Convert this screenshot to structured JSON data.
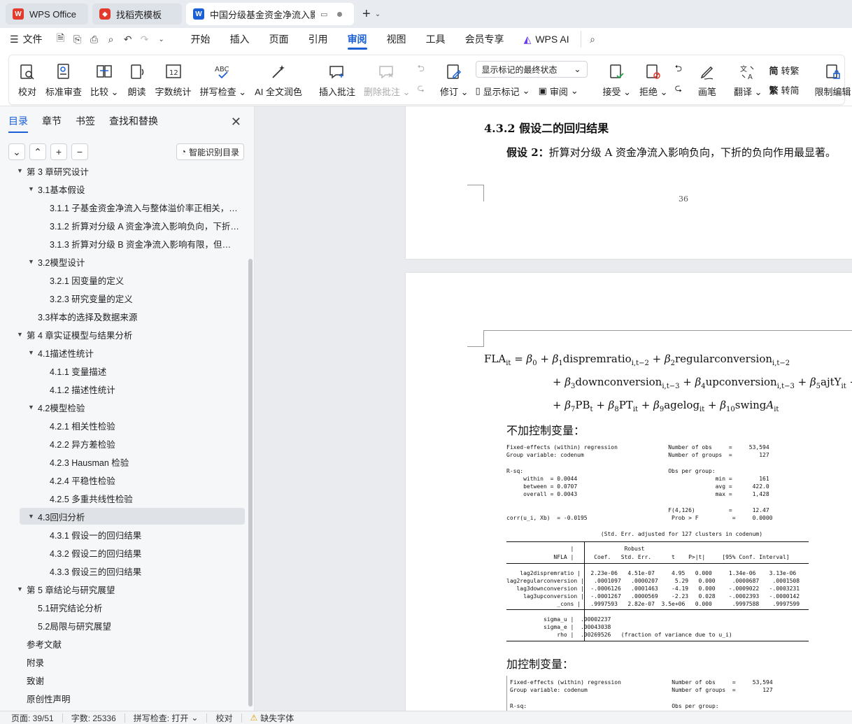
{
  "titlebar": {
    "tabs": [
      {
        "label": "WPS Office",
        "icon": "wps-logo-icon"
      },
      {
        "label": "找稻壳模板",
        "icon": "docer-icon"
      },
      {
        "label": "中国分级基金资金净流入影响因",
        "icon": "writer-w-icon"
      }
    ],
    "new_tab": "+"
  },
  "menubar": {
    "file": "文件",
    "items": [
      "开始",
      "插入",
      "页面",
      "引用",
      "审阅",
      "视图",
      "工具",
      "会员专享",
      "WPS AI"
    ],
    "active": "审阅"
  },
  "ribbon": {
    "proof": "校对",
    "standard_review": "标准审查",
    "compare": "比较",
    "read_aloud": "朗读",
    "word_count": "字数统计",
    "spell_check": "拼写检查",
    "ai_polish": "AI 全文润色",
    "insert_comment": "插入批注",
    "delete_comment": "删除批注",
    "revise": "修订",
    "markup_state": "显示标记的最终状态",
    "show_markup": "显示标记",
    "review": "审阅",
    "accept": "接受",
    "reject": "拒绝",
    "pen": "画笔",
    "translate": "翻译",
    "to_traditional": "转繁",
    "to_simplified": "转简",
    "restrict_edit": "限制编辑"
  },
  "sidebar": {
    "tabs": [
      "目录",
      "章节",
      "书签",
      "查找和替换"
    ],
    "smart_toc": "智能识别目录",
    "toc": [
      {
        "label": "第 3 章研究设计",
        "level": 0,
        "arrow": true
      },
      {
        "label": "3.1基本假设",
        "level": 1,
        "arrow": true
      },
      {
        "label": "3.1.1 子基金资金净流入与整体溢价率正相关，与 ...",
        "level": 2
      },
      {
        "label": "3.1.2 折算对分级 A 资金净流入影响负向，下折 ...",
        "level": 2
      },
      {
        "label": "3.1.3 折算对分级 B 资金净流入影响有限，但上折 ...",
        "level": 2
      },
      {
        "label": "3.2模型设计",
        "level": 1,
        "arrow": true
      },
      {
        "label": "3.2.1 因变量的定义",
        "level": 2
      },
      {
        "label": "3.2.3 研究变量的定义",
        "level": 2
      },
      {
        "label": "3.3样本的选择及数据来源",
        "level": 1
      },
      {
        "label": "第 4 章实证模型与结果分析",
        "level": 0,
        "arrow": true
      },
      {
        "label": "4.1描述性统计",
        "level": 1,
        "arrow": true
      },
      {
        "label": "4.1.1 变量描述",
        "level": 2
      },
      {
        "label": "4.1.2 描述性统计",
        "level": 2
      },
      {
        "label": "4.2模型检验",
        "level": 1,
        "arrow": true
      },
      {
        "label": "4.2.1  相关性检验",
        "level": 2
      },
      {
        "label": "4.2.2  异方差检验",
        "level": 2
      },
      {
        "label": "4.2.3 Hausman 检验",
        "level": 2
      },
      {
        "label": "4.2.4  平稳性检验",
        "level": 2
      },
      {
        "label": "4.2.5  多重共线性检验",
        "level": 2
      },
      {
        "label": "4.3回归分析",
        "level": 1,
        "arrow": true,
        "selected": true
      },
      {
        "label": "4.3.1 假设一的回归结果",
        "level": 2
      },
      {
        "label": "4.3.2 假设二的回归结果",
        "level": 2
      },
      {
        "label": "4.3.3 假设三的回归结果",
        "level": 2
      },
      {
        "label": "第 5 章结论与研究展望",
        "level": 0,
        "arrow": true
      },
      {
        "label": "5.1研究结论分析",
        "level": 1
      },
      {
        "label": "5.2局限与研究展望",
        "level": 1
      },
      {
        "label": "参考文献",
        "level": 0
      },
      {
        "label": "附录",
        "level": 0
      },
      {
        "label": "致谢",
        "level": 0
      },
      {
        "label": "原创性声明",
        "level": 0
      }
    ]
  },
  "document": {
    "heading": "4.3.2 假设二的回归结果",
    "hypothesis_label": "假设 2：",
    "hypothesis_text": "折算对分级 A 资金净流入影响负向，下折的负向作用最显著。",
    "page_number": "36",
    "no_control_label": "不加控制变量：",
    "with_control_label": "加控制变量：",
    "stata1": {
      "l1": "Fixed-effects (within) regression               Number of obs     =     53,594",
      "l2": "Group variable: codenum                         Number of groups  =        127",
      "l3": "",
      "l4": "R-sq:                                           Obs per group:",
      "l5": "     within  = 0.0044                                         min =        161",
      "l6": "     between = 0.0707                                         avg =      422.0",
      "l7": "     overall = 0.0043                                         max =      1,428",
      "l8": "",
      "l9": "                                                F(4,126)          =      12.47",
      "l10": "corr(u_i, Xb)  = -0.0195                         Prob > F          =     0.0000",
      "l11": "",
      "l12": "                            (Std. Err. adjusted for 127 clusters in codenum)",
      "t1": "                   |               Robust",
      "t2": "              NFLA |      Coef.   Std. Err.      t    P>|t|     [95% Conf. Interval]",
      "t3": "    lag2dispremratio |   2.23e-06   4.51e-07     4.95   0.000     1.34e-06    3.13e-06",
      "t4": "lag2regularconversion |   .0001097   .0000207     5.29   0.000     .0000687    .0001508",
      "t5": "   lag3downconversion |  -.0006126   .0001463    -4.19   0.000    -.0009022   -.0003231",
      "t6": "     lag3upconversion |  -.0001267   .0000569    -2.23   0.028    -.0002393   -.0000142",
      "t7": "               _cons |   .9997593   2.82e-07  3.5e+06   0.000      .9997588    .9997599",
      "t8": "           sigma_u |  .00002237",
      "t9": "           sigma_e |  .00043038",
      "t10": "               rho |  .00269526   (fraction of variance due to u_i)"
    },
    "stata2": {
      "l1": "Fixed-effects (within) regression               Number of obs     =     53,594",
      "l2": "Group variable: codenum                         Number of groups  =        127",
      "l3": "",
      "l4": "R-sq:                                           Obs per group:"
    }
  },
  "statusbar": {
    "page": "页面: 39/51",
    "words": "字数: 25336",
    "spell": "拼写检查: 打开",
    "proof": "校对",
    "missing_font": "缺失字体"
  },
  "colors": {
    "accent": "#1a5fd6",
    "wps_red": "#e23b2e"
  }
}
